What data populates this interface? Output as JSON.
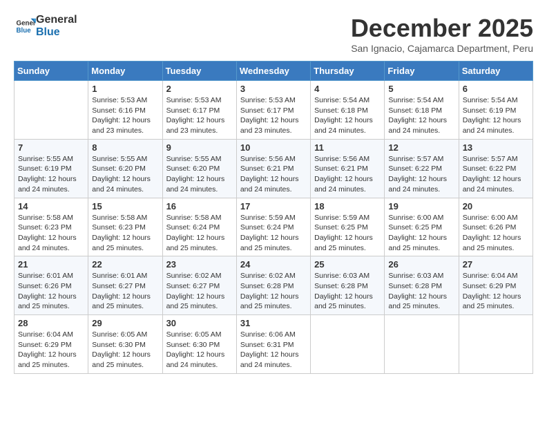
{
  "header": {
    "logo_general": "General",
    "logo_blue": "Blue",
    "month_title": "December 2025",
    "location": "San Ignacio, Cajamarca Department, Peru"
  },
  "weekdays": [
    "Sunday",
    "Monday",
    "Tuesday",
    "Wednesday",
    "Thursday",
    "Friday",
    "Saturday"
  ],
  "weeks": [
    [
      {
        "day": "",
        "sunrise": "",
        "sunset": "",
        "daylight": ""
      },
      {
        "day": "1",
        "sunrise": "Sunrise: 5:53 AM",
        "sunset": "Sunset: 6:16 PM",
        "daylight": "Daylight: 12 hours and 23 minutes."
      },
      {
        "day": "2",
        "sunrise": "Sunrise: 5:53 AM",
        "sunset": "Sunset: 6:17 PM",
        "daylight": "Daylight: 12 hours and 23 minutes."
      },
      {
        "day": "3",
        "sunrise": "Sunrise: 5:53 AM",
        "sunset": "Sunset: 6:17 PM",
        "daylight": "Daylight: 12 hours and 23 minutes."
      },
      {
        "day": "4",
        "sunrise": "Sunrise: 5:54 AM",
        "sunset": "Sunset: 6:18 PM",
        "daylight": "Daylight: 12 hours and 24 minutes."
      },
      {
        "day": "5",
        "sunrise": "Sunrise: 5:54 AM",
        "sunset": "Sunset: 6:18 PM",
        "daylight": "Daylight: 12 hours and 24 minutes."
      },
      {
        "day": "6",
        "sunrise": "Sunrise: 5:54 AM",
        "sunset": "Sunset: 6:19 PM",
        "daylight": "Daylight: 12 hours and 24 minutes."
      }
    ],
    [
      {
        "day": "7",
        "sunrise": "Sunrise: 5:55 AM",
        "sunset": "Sunset: 6:19 PM",
        "daylight": "Daylight: 12 hours and 24 minutes."
      },
      {
        "day": "8",
        "sunrise": "Sunrise: 5:55 AM",
        "sunset": "Sunset: 6:20 PM",
        "daylight": "Daylight: 12 hours and 24 minutes."
      },
      {
        "day": "9",
        "sunrise": "Sunrise: 5:55 AM",
        "sunset": "Sunset: 6:20 PM",
        "daylight": "Daylight: 12 hours and 24 minutes."
      },
      {
        "day": "10",
        "sunrise": "Sunrise: 5:56 AM",
        "sunset": "Sunset: 6:21 PM",
        "daylight": "Daylight: 12 hours and 24 minutes."
      },
      {
        "day": "11",
        "sunrise": "Sunrise: 5:56 AM",
        "sunset": "Sunset: 6:21 PM",
        "daylight": "Daylight: 12 hours and 24 minutes."
      },
      {
        "day": "12",
        "sunrise": "Sunrise: 5:57 AM",
        "sunset": "Sunset: 6:22 PM",
        "daylight": "Daylight: 12 hours and 24 minutes."
      },
      {
        "day": "13",
        "sunrise": "Sunrise: 5:57 AM",
        "sunset": "Sunset: 6:22 PM",
        "daylight": "Daylight: 12 hours and 24 minutes."
      }
    ],
    [
      {
        "day": "14",
        "sunrise": "Sunrise: 5:58 AM",
        "sunset": "Sunset: 6:23 PM",
        "daylight": "Daylight: 12 hours and 24 minutes."
      },
      {
        "day": "15",
        "sunrise": "Sunrise: 5:58 AM",
        "sunset": "Sunset: 6:23 PM",
        "daylight": "Daylight: 12 hours and 25 minutes."
      },
      {
        "day": "16",
        "sunrise": "Sunrise: 5:58 AM",
        "sunset": "Sunset: 6:24 PM",
        "daylight": "Daylight: 12 hours and 25 minutes."
      },
      {
        "day": "17",
        "sunrise": "Sunrise: 5:59 AM",
        "sunset": "Sunset: 6:24 PM",
        "daylight": "Daylight: 12 hours and 25 minutes."
      },
      {
        "day": "18",
        "sunrise": "Sunrise: 5:59 AM",
        "sunset": "Sunset: 6:25 PM",
        "daylight": "Daylight: 12 hours and 25 minutes."
      },
      {
        "day": "19",
        "sunrise": "Sunrise: 6:00 AM",
        "sunset": "Sunset: 6:25 PM",
        "daylight": "Daylight: 12 hours and 25 minutes."
      },
      {
        "day": "20",
        "sunrise": "Sunrise: 6:00 AM",
        "sunset": "Sunset: 6:26 PM",
        "daylight": "Daylight: 12 hours and 25 minutes."
      }
    ],
    [
      {
        "day": "21",
        "sunrise": "Sunrise: 6:01 AM",
        "sunset": "Sunset: 6:26 PM",
        "daylight": "Daylight: 12 hours and 25 minutes."
      },
      {
        "day": "22",
        "sunrise": "Sunrise: 6:01 AM",
        "sunset": "Sunset: 6:27 PM",
        "daylight": "Daylight: 12 hours and 25 minutes."
      },
      {
        "day": "23",
        "sunrise": "Sunrise: 6:02 AM",
        "sunset": "Sunset: 6:27 PM",
        "daylight": "Daylight: 12 hours and 25 minutes."
      },
      {
        "day": "24",
        "sunrise": "Sunrise: 6:02 AM",
        "sunset": "Sunset: 6:28 PM",
        "daylight": "Daylight: 12 hours and 25 minutes."
      },
      {
        "day": "25",
        "sunrise": "Sunrise: 6:03 AM",
        "sunset": "Sunset: 6:28 PM",
        "daylight": "Daylight: 12 hours and 25 minutes."
      },
      {
        "day": "26",
        "sunrise": "Sunrise: 6:03 AM",
        "sunset": "Sunset: 6:28 PM",
        "daylight": "Daylight: 12 hours and 25 minutes."
      },
      {
        "day": "27",
        "sunrise": "Sunrise: 6:04 AM",
        "sunset": "Sunset: 6:29 PM",
        "daylight": "Daylight: 12 hours and 25 minutes."
      }
    ],
    [
      {
        "day": "28",
        "sunrise": "Sunrise: 6:04 AM",
        "sunset": "Sunset: 6:29 PM",
        "daylight": "Daylight: 12 hours and 25 minutes."
      },
      {
        "day": "29",
        "sunrise": "Sunrise: 6:05 AM",
        "sunset": "Sunset: 6:30 PM",
        "daylight": "Daylight: 12 hours and 25 minutes."
      },
      {
        "day": "30",
        "sunrise": "Sunrise: 6:05 AM",
        "sunset": "Sunset: 6:30 PM",
        "daylight": "Daylight: 12 hours and 24 minutes."
      },
      {
        "day": "31",
        "sunrise": "Sunrise: 6:06 AM",
        "sunset": "Sunset: 6:31 PM",
        "daylight": "Daylight: 12 hours and 24 minutes."
      },
      {
        "day": "",
        "sunrise": "",
        "sunset": "",
        "daylight": ""
      },
      {
        "day": "",
        "sunrise": "",
        "sunset": "",
        "daylight": ""
      },
      {
        "day": "",
        "sunrise": "",
        "sunset": "",
        "daylight": ""
      }
    ]
  ]
}
